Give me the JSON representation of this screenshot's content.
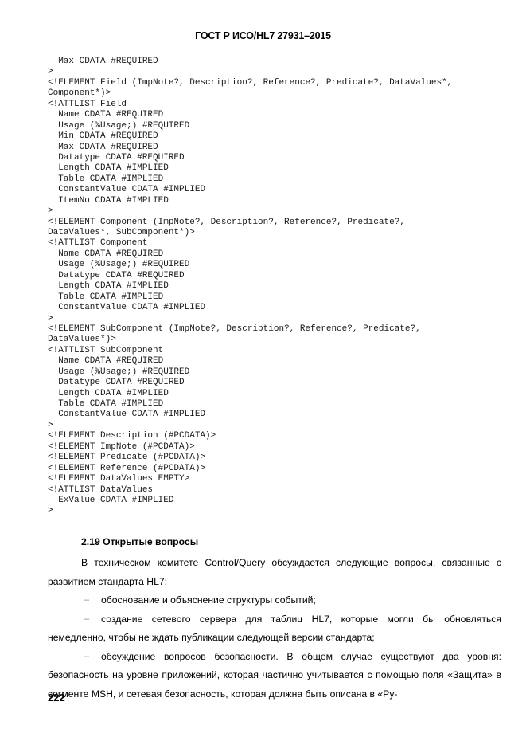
{
  "header": {
    "running_title": "ГОСТ Р ИСО/HL7 27931–2015"
  },
  "code_listing": {
    "language": "dtd",
    "lines": [
      "  Max CDATA #REQUIRED",
      ">",
      "<!ELEMENT Field (ImpNote?, Description?, Reference?, Predicate?, DataValues*,",
      "Component*)>",
      "<!ATTLIST Field",
      "  Name CDATA #REQUIRED",
      "  Usage (%Usage;) #REQUIRED",
      "  Min CDATA #REQUIRED",
      "  Max CDATA #REQUIRED",
      "  Datatype CDATA #REQUIRED",
      "  Length CDATA #IMPLIED",
      "  Table CDATA #IMPLIED",
      "  ConstantValue CDATA #IMPLIED",
      "  ItemNo CDATA #IMPLIED",
      ">",
      "<!ELEMENT Component (ImpNote?, Description?, Reference?, Predicate?,",
      "DataValues*, SubComponent*)>",
      "<!ATTLIST Component",
      "  Name CDATA #REQUIRED",
      "  Usage (%Usage;) #REQUIRED",
      "  Datatype CDATA #REQUIRED",
      "  Length CDATA #IMPLIED",
      "  Table CDATA #IMPLIED",
      "  ConstantValue CDATA #IMPLIED",
      ">",
      "<!ELEMENT SubComponent (ImpNote?, Description?, Reference?, Predicate?,",
      "DataValues*)>",
      "<!ATTLIST SubComponent",
      "  Name CDATA #REQUIRED",
      "  Usage (%Usage;) #REQUIRED",
      "  Datatype CDATA #REQUIRED",
      "  Length CDATA #IMPLIED",
      "  Table CDATA #IMPLIED",
      "  ConstantValue CDATA #IMPLIED",
      ">",
      "<!ELEMENT Description (#PCDATA)>",
      "<!ELEMENT ImpNote (#PCDATA)>",
      "<!ELEMENT Predicate (#PCDATA)>",
      "<!ELEMENT Reference (#PCDATA)>",
      "<!ELEMENT DataValues EMPTY>",
      "<!ATTLIST DataValues",
      "  ExValue CDATA #IMPLIED",
      ">"
    ]
  },
  "section": {
    "number_and_title": "2.19 Открытые вопросы",
    "intro_paragraph": "В техническом комитете Control/Query обсуждается следующие вопросы, связанные с развитием стандарта HL7:",
    "bullet_marker": "–",
    "bullets": [
      "обоснование и объяснение структуры событий;",
      "создание сетевого сервера для таблиц HL7, которые могли бы обновляться немедленно, чтобы не ждать публикации следующей версии стандарта;",
      "обсуждение вопросов безопасности. В общем случае существуют два уровня: безопасность на уровне приложений, которая частично учитывается с помощью поля «Защита» в сегменте MSH, и сетевая безопасность, которая должна быть описана в «Ру-"
    ]
  },
  "footer": {
    "page_number": "222"
  }
}
